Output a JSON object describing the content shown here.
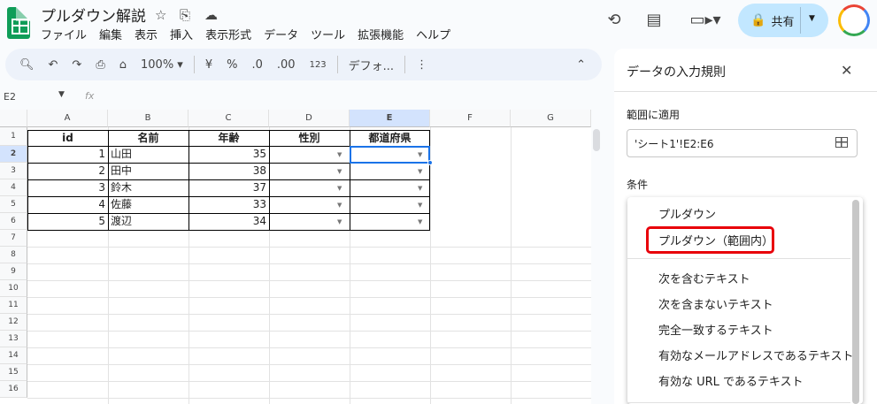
{
  "app": {
    "title": "プルダウン解説"
  },
  "menubar": [
    "ファイル",
    "編集",
    "表示",
    "挿入",
    "表示形式",
    "データ",
    "ツール",
    "拡張機能",
    "ヘルプ"
  ],
  "share": {
    "label": "共有"
  },
  "toolbar": {
    "zoom": "100%",
    "currency": "¥",
    "percent": "%",
    "dec_decrease": ".0",
    "dec_increase": ".00",
    "numformat": "123",
    "font": "デフォ..."
  },
  "formula_bar": {
    "cell_ref": "E2",
    "fx": "fx"
  },
  "grid": {
    "columns": [
      "A",
      "B",
      "C",
      "D",
      "E",
      "F",
      "G"
    ],
    "rows": [
      "1",
      "2",
      "3",
      "4",
      "5",
      "6",
      "7",
      "8",
      "9",
      "10",
      "11",
      "12",
      "13",
      "14",
      "15",
      "16"
    ],
    "headers": [
      "id",
      "名前",
      "年齢",
      "性別",
      "都道府県"
    ],
    "data": [
      [
        "1",
        "山田",
        "35"
      ],
      [
        "2",
        "田中",
        "38"
      ],
      [
        "3",
        "鈴木",
        "37"
      ],
      [
        "4",
        "佐藤",
        "33"
      ],
      [
        "5",
        "渡辺",
        "34"
      ]
    ]
  },
  "panel": {
    "title": "データの入力規則",
    "range_label": "範囲に適用",
    "range_value": "'シート1'!E2:E6",
    "condition_label": "条件",
    "menu_items": [
      "プルダウン",
      "プルダウン（範囲内）",
      "次を含むテキスト",
      "次を含まないテキスト",
      "完全一致するテキスト",
      "有効なメールアドレスであるテキスト",
      "有効な URL であるテキスト"
    ]
  }
}
